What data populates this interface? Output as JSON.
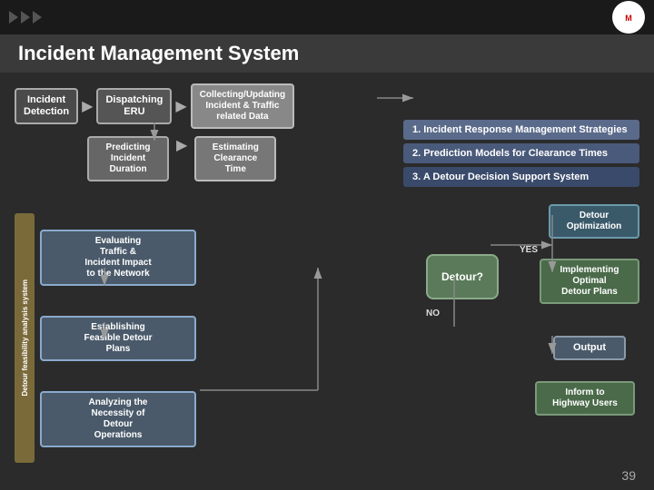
{
  "slide": {
    "title": "Incident Management System",
    "slide_number": "39"
  },
  "top_bar": {
    "arrows": [
      "arrow1",
      "arrow2",
      "arrow3"
    ]
  },
  "flow_boxes": {
    "incident_detection": "Incident\nDetection",
    "dispatching_eru": "Dispatching\nERU",
    "collecting_updating": "Collecting/Updating\nIncident & Traffic\nrelated Data"
  },
  "numbered_items": [
    "1. Incident Response Management Strategies",
    "2. Prediction Models for Clearance Times",
    "3. A Detour Decision Support System"
  ],
  "middle_boxes": {
    "predicting": "Predicting\nIncident\nDuration",
    "estimating": "Estimating\nClearance\nTime"
  },
  "detour_section": {
    "vertical_label": "Detour feasibility analysis system",
    "boxes": [
      "Evaluating\nTraffic &\nIncident Impact\nto the Network",
      "Establishing\nFeasible Detour\nPlans",
      "Analyzing the\nNecessity of\nDetour\nOperations"
    ]
  },
  "right_flow": {
    "detour_question": "Detour?",
    "yes_label": "YES",
    "no_label": "NO",
    "detour_optimization": "Detour\nOptimization",
    "implementing": "Implementing\nOptimal\nDetour Plans",
    "output": "Output",
    "inform": "Inform to\nHighway Users"
  }
}
